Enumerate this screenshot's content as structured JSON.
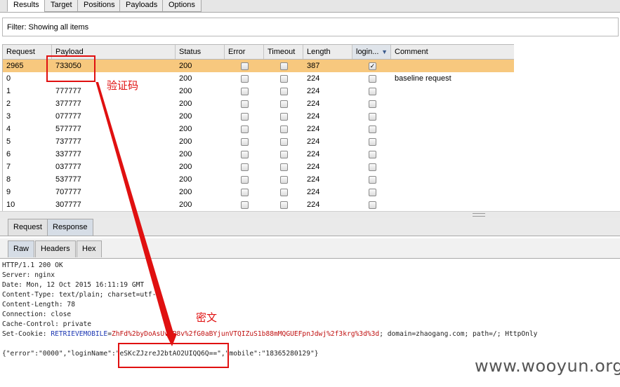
{
  "top_tabs": [
    {
      "label": "Results",
      "active": true
    },
    {
      "label": "Target",
      "active": false
    },
    {
      "label": "Positions",
      "active": false
    },
    {
      "label": "Payloads",
      "active": false
    },
    {
      "label": "Options",
      "active": false
    }
  ],
  "filter": {
    "text": "Filter: Showing all items"
  },
  "table": {
    "columns": [
      "Request",
      "Payload",
      "Status",
      "Error",
      "Timeout",
      "Length",
      "login...",
      "Comment"
    ],
    "rows": [
      {
        "request": "2965",
        "payload": "733050",
        "status": "200",
        "error": false,
        "timeout": false,
        "length": "387",
        "login": true,
        "comment": "",
        "selected": true
      },
      {
        "request": "0",
        "payload": "",
        "status": "200",
        "error": false,
        "timeout": false,
        "length": "224",
        "login": false,
        "comment": "baseline request",
        "selected": false
      },
      {
        "request": "1",
        "payload": "777777",
        "status": "200",
        "error": false,
        "timeout": false,
        "length": "224",
        "login": false,
        "comment": "",
        "selected": false
      },
      {
        "request": "2",
        "payload": "377777",
        "status": "200",
        "error": false,
        "timeout": false,
        "length": "224",
        "login": false,
        "comment": "",
        "selected": false
      },
      {
        "request": "3",
        "payload": "077777",
        "status": "200",
        "error": false,
        "timeout": false,
        "length": "224",
        "login": false,
        "comment": "",
        "selected": false
      },
      {
        "request": "4",
        "payload": "577777",
        "status": "200",
        "error": false,
        "timeout": false,
        "length": "224",
        "login": false,
        "comment": "",
        "selected": false
      },
      {
        "request": "5",
        "payload": "737777",
        "status": "200",
        "error": false,
        "timeout": false,
        "length": "224",
        "login": false,
        "comment": "",
        "selected": false
      },
      {
        "request": "6",
        "payload": "337777",
        "status": "200",
        "error": false,
        "timeout": false,
        "length": "224",
        "login": false,
        "comment": "",
        "selected": false
      },
      {
        "request": "7",
        "payload": "037777",
        "status": "200",
        "error": false,
        "timeout": false,
        "length": "224",
        "login": false,
        "comment": "",
        "selected": false
      },
      {
        "request": "8",
        "payload": "537777",
        "status": "200",
        "error": false,
        "timeout": false,
        "length": "224",
        "login": false,
        "comment": "",
        "selected": false
      },
      {
        "request": "9",
        "payload": "707777",
        "status": "200",
        "error": false,
        "timeout": false,
        "length": "224",
        "login": false,
        "comment": "",
        "selected": false
      },
      {
        "request": "10",
        "payload": "307777",
        "status": "200",
        "error": false,
        "timeout": false,
        "length": "224",
        "login": false,
        "comment": "",
        "selected": false
      }
    ]
  },
  "message_tabs": [
    {
      "label": "Request",
      "active": false
    },
    {
      "label": "Response",
      "active": true
    }
  ],
  "view_tabs": [
    {
      "label": "Raw",
      "active": true
    },
    {
      "label": "Headers",
      "active": false
    },
    {
      "label": "Hex",
      "active": false
    }
  ],
  "response": {
    "status_line": "HTTP/1.1 200 OK",
    "server": "Server: nginx",
    "date": "Date: Mon, 12 Oct 2015 16:11:19 GMT",
    "content_type": "Content-Type: text/plain; charset=utf-8",
    "content_length": "Content-Length: 78",
    "connection": "Connection: close",
    "cache_control": "Cache-Control: private",
    "set_cookie_prefix": "Set-Cookie: ",
    "cookie_name": "RETRIEVEMOBILE",
    "cookie_eq": "=",
    "cookie_value": "ZhFd%2byDoAsUvGP8v%2fG0aBYjunVTQIZuS1b88mMQGUEFpnJdwj%2f3krg%3d%3d",
    "cookie_rest": "; domain=zhaogang.com; path=/; HttpOnly",
    "body": "{\"error\":\"0000\",\"loginName\":\"eSKcZJzreJ2btAO2UIQQ6Q==\",\"mobile\":\"18365280129\"}"
  },
  "annotations": {
    "captcha_label": "验证码",
    "cipher_label": "密文",
    "arrow_color": "#e01010"
  },
  "watermark": "www.wooyun.org"
}
